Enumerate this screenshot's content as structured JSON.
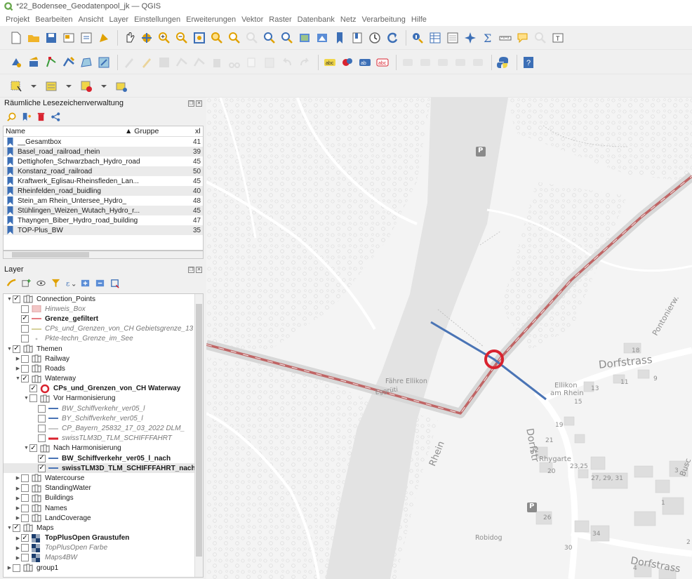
{
  "window": {
    "title": "*22_Bodensee_Geodatenpool_jk — QGIS"
  },
  "menu": [
    "Projekt",
    "Bearbeiten",
    "Ansicht",
    "Layer",
    "Einstellungen",
    "Erweiterungen",
    "Vektor",
    "Raster",
    "Datenbank",
    "Netz",
    "Verarbeitung",
    "Hilfe"
  ],
  "bookmarks_panel": {
    "title": "Räumliche Lesezeichenverwaltung",
    "col_name": "Name",
    "col_group": "▲ Gruppe",
    "col_x": "xl",
    "rows": [
      {
        "name": "__Gesamtbox",
        "x": "41"
      },
      {
        "name": "Basel_road_railroad_rhein",
        "x": "39"
      },
      {
        "name": "Dettighofen_Schwarzbach_Hydro_road",
        "x": "45"
      },
      {
        "name": "Konstanz_road_railroad",
        "x": "50"
      },
      {
        "name": "Kraftwerk_Eglisau-Rheinsfleden_Lan...",
        "x": "45"
      },
      {
        "name": "Rheinfelden_road_buidling",
        "x": "40"
      },
      {
        "name": "Stein_am Rhein_Untersee_Hydro_",
        "x": "48"
      },
      {
        "name": "Stühlingen_Weizen_Wutach_Hydro_r...",
        "x": "45"
      },
      {
        "name": "Thayngen_Biber_Hydro_road_building",
        "x": "47"
      },
      {
        "name": "TOP-Plus_BW",
        "x": "35"
      }
    ]
  },
  "layers_panel": {
    "title": "Layer",
    "items": [
      {
        "label": "Connection_Points",
        "level": 0,
        "arrow": "▼",
        "checked": true,
        "kind": "group",
        "style": ""
      },
      {
        "label": "Hinweis_Box",
        "level": 1,
        "arrow": "",
        "checked": false,
        "kind": "fill-pink",
        "style": "ital"
      },
      {
        "label": "Grenze_gefiltert",
        "level": 1,
        "arrow": "",
        "checked": true,
        "kind": "line-pink",
        "style": "bold"
      },
      {
        "label": "CPs_und_Grenzen_von_CH Gebietsgrenze_13",
        "level": 1,
        "arrow": "",
        "checked": false,
        "kind": "line-olive",
        "style": "ital"
      },
      {
        "label": "Pkte-techn_Grenze_im_See",
        "level": 1,
        "arrow": "",
        "checked": false,
        "kind": "dot-grey",
        "style": "ital"
      },
      {
        "label": "Themen",
        "level": 0,
        "arrow": "▼",
        "checked": true,
        "kind": "group",
        "style": ""
      },
      {
        "label": "Railway",
        "level": 1,
        "arrow": "▶",
        "checked": false,
        "kind": "group",
        "style": ""
      },
      {
        "label": "Roads",
        "level": 1,
        "arrow": "▶",
        "checked": false,
        "kind": "group",
        "style": ""
      },
      {
        "label": "Waterway",
        "level": 1,
        "arrow": "▼",
        "checked": true,
        "kind": "group",
        "style": ""
      },
      {
        "label": "CPs_und_Grenzen_von_CH Waterway",
        "level": 2,
        "arrow": "",
        "checked": true,
        "kind": "circle-red",
        "style": "bold"
      },
      {
        "label": "Vor Harmonisierung",
        "level": 2,
        "arrow": "▼",
        "checked": false,
        "kind": "group",
        "style": ""
      },
      {
        "label": "BW_Schiffverkehr_ver05_l",
        "level": 3,
        "arrow": "",
        "checked": false,
        "kind": "line-blue",
        "style": "ital"
      },
      {
        "label": "BY_Schiffverkehr_ver05_l",
        "level": 3,
        "arrow": "",
        "checked": false,
        "kind": "line-blue",
        "style": "ital"
      },
      {
        "label": "CP_Bayern_25832_17_03_2022 DLM_",
        "level": 3,
        "arrow": "",
        "checked": false,
        "kind": "line-grey",
        "style": "ital"
      },
      {
        "label": "swissTLM3D_TLM_SCHIFFFAHRT",
        "level": 3,
        "arrow": "",
        "checked": false,
        "kind": "line-red",
        "style": "ital"
      },
      {
        "label": "Nach Harmonisierung",
        "level": 2,
        "arrow": "▼",
        "checked": true,
        "kind": "group",
        "style": ""
      },
      {
        "label": "BW_Schiffverkehr_ver05_l_nach",
        "level": 3,
        "arrow": "",
        "checked": true,
        "kind": "line-blue",
        "style": "bold"
      },
      {
        "label": "swissTLM3D_TLM_SCHIFFFAHRT_nach",
        "level": 3,
        "arrow": "",
        "checked": true,
        "kind": "line-blue",
        "style": "bold",
        "selected": true
      },
      {
        "label": "Watercourse",
        "level": 1,
        "arrow": "▶",
        "checked": false,
        "kind": "group",
        "style": ""
      },
      {
        "label": "StandingWater",
        "level": 1,
        "arrow": "▶",
        "checked": false,
        "kind": "group",
        "style": ""
      },
      {
        "label": "Buildings",
        "level": 1,
        "arrow": "▶",
        "checked": false,
        "kind": "group",
        "style": ""
      },
      {
        "label": "Names",
        "level": 1,
        "arrow": "▶",
        "checked": false,
        "kind": "group",
        "style": ""
      },
      {
        "label": "LandCoverage",
        "level": 1,
        "arrow": "▶",
        "checked": false,
        "kind": "group",
        "style": ""
      },
      {
        "label": "Maps",
        "level": 0,
        "arrow": "▼",
        "checked": true,
        "kind": "group",
        "style": ""
      },
      {
        "label": "TopPlusOpen Graustufen",
        "level": 1,
        "arrow": "▶",
        "checked": true,
        "kind": "raster",
        "style": "bold"
      },
      {
        "label": "TopPlusOpen Farbe",
        "level": 1,
        "arrow": "▶",
        "checked": false,
        "kind": "raster",
        "style": "ital"
      },
      {
        "label": "Maps4BW",
        "level": 1,
        "arrow": "▶",
        "checked": false,
        "kind": "raster",
        "style": "ital"
      },
      {
        "label": "group1",
        "level": 0,
        "arrow": "▶",
        "checked": false,
        "kind": "group",
        "style": ""
      }
    ]
  },
  "map_labels": {
    "dorfstrass_1": "Dorfstrass",
    "pontonierw": "Pontonierw.",
    "faehre": "Fähre Ellikon",
    "eggrueti": "Eggrüti",
    "ellikon": "Ellikon",
    "am_rhein": "am Rhein",
    "rhein": "Rhein",
    "dorfstr": "Dorfstr",
    "rhygarte": "Rhygarte",
    "robidog": "Robidog",
    "dorfstrass_2": "Dorfstrass",
    "busch": "Busc",
    "parking": "P",
    "h18": "18",
    "h13": "13",
    "h11": "11",
    "h9": "9",
    "h15": "15",
    "h19": "19",
    "h21": "21",
    "h22": "22",
    "h20": "20",
    "h2325": "23,25",
    "h272931": "27, 29, 31",
    "h26": "26",
    "h34": "34",
    "h30": "30",
    "h3": "3",
    "h1": "1",
    "h4": "4",
    "h2": "2"
  },
  "colors": {
    "accent_red": "#d9232f",
    "border_line": "#c06565",
    "waterway_blue": "#4a74b5",
    "map_bg": "#f4f4f4",
    "river": "#e3e3e3"
  }
}
